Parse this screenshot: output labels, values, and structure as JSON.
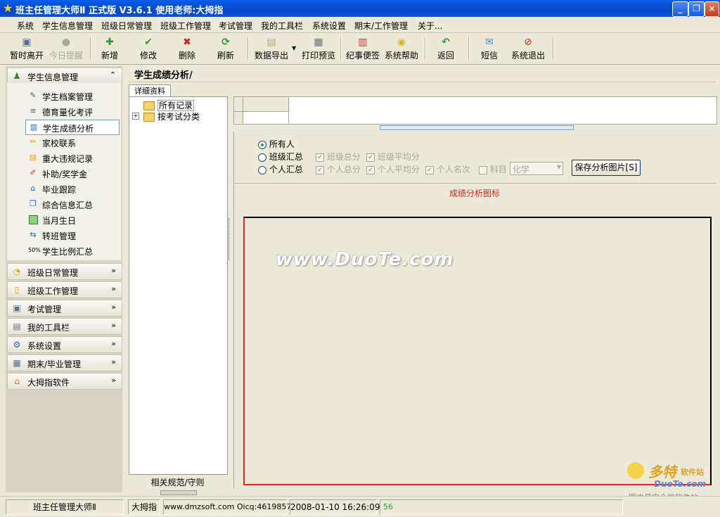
{
  "window": {
    "title": "班主任管理大师Ⅱ  正式版 V3.6.1   使用老师:大拇指"
  },
  "menu": [
    "系统",
    "学生信息管理",
    "班级日常管理",
    "班级工作管理",
    "考试管理",
    "我的工具栏",
    "系统设置",
    "期末/工作管理",
    "关于..."
  ],
  "toolbar": {
    "pause": "暂时离开",
    "today": "今日提醒",
    "add": "新增",
    "edit": "修改",
    "delete": "删除",
    "refresh": "刷新",
    "export": "数据导出",
    "print": "打印预览",
    "notes": "纪事便签",
    "help": "系统帮助",
    "back": "返回",
    "sms": "短信",
    "exit": "系统退出"
  },
  "sidebar": {
    "open_section": "学生信息管理",
    "items": [
      "学生档案管理",
      "德育量化考评",
      "学生成绩分析",
      "家校联系",
      "重大违规记录",
      "补助/奖学金",
      "毕业跟踪",
      "综合信息汇总",
      "当月生日",
      "转班管理",
      "学生比例汇总"
    ],
    "sections": [
      "班级日常管理",
      "班级工作管理",
      "考试管理",
      "我的工具栏",
      "系统设置",
      "期末/毕业管理",
      "大拇指软件"
    ]
  },
  "content": {
    "title": "学生成绩分析/",
    "tab": "详细资料",
    "tree_root": "所有记录",
    "tree_child": "按考试分类",
    "tree_footer": "相关规范/守则"
  },
  "options": {
    "all": "所有人",
    "class_summary": "班级汇总",
    "class_total": "班级总分",
    "class_avg": "班级平均分",
    "personal_summary": "个人汇总",
    "personal_total": "个人总分",
    "personal_avg": "个人平均分",
    "personal_rank": "个人名次",
    "subject": "科目",
    "subject_value": "化学",
    "save_button": "保存分析图片[S]"
  },
  "chart": {
    "title": "成绩分析图标"
  },
  "watermark": "www.DuoTe.com",
  "statusbar": {
    "app": "班主任管理大师Ⅱ",
    "user": "大拇指",
    "site": "www.dmzsoft.com Oicq:4619857",
    "datetime": "2008-01-10  16:26:09",
    "count": "56"
  },
  "logo": {
    "brand": "多特",
    "suffix": "软件站",
    "site": "DuoTe.com",
    "tag": "国内最安全的软件站"
  }
}
